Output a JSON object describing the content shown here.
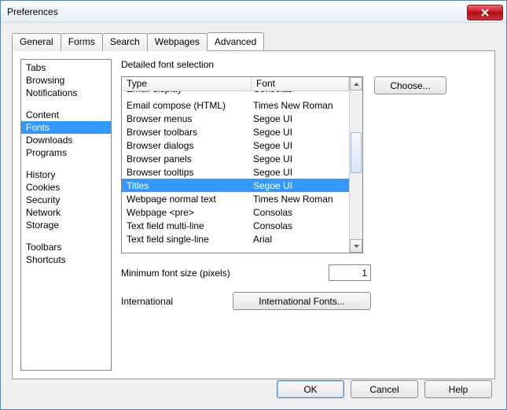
{
  "window": {
    "title": "Preferences"
  },
  "tabs": {
    "items": [
      "General",
      "Forms",
      "Search",
      "Webpages",
      "Advanced"
    ],
    "active": "Advanced"
  },
  "sidebar": {
    "groups": [
      [
        "Tabs",
        "Browsing",
        "Notifications"
      ],
      [
        "Content",
        "Fonts",
        "Downloads",
        "Programs"
      ],
      [
        "History",
        "Cookies",
        "Security",
        "Network",
        "Storage"
      ],
      [
        "Toolbars",
        "Shortcuts"
      ]
    ],
    "selected": "Fonts"
  },
  "main": {
    "heading": "Detailed font selection",
    "columns": {
      "type": "Type",
      "font": "Font"
    },
    "rows": [
      {
        "type": "Email display",
        "font": "Consolas"
      },
      {
        "type": "Email compose (HTML)",
        "font": "Times New Roman"
      },
      {
        "type": "Browser menus",
        "font": "Segoe UI"
      },
      {
        "type": "Browser toolbars",
        "font": "Segoe UI"
      },
      {
        "type": "Browser dialogs",
        "font": "Segoe UI"
      },
      {
        "type": "Browser panels",
        "font": "Segoe UI"
      },
      {
        "type": "Browser tooltips",
        "font": "Segoe UI"
      },
      {
        "type": "Titles",
        "font": "Segoe UI"
      },
      {
        "type": "Webpage normal text",
        "font": "Times New Roman"
      },
      {
        "type": "Webpage <pre>",
        "font": "Consolas"
      },
      {
        "type": "Text field multi-line",
        "font": "Consolas"
      },
      {
        "type": "Text field single-line",
        "font": "Arial"
      }
    ],
    "selected_row_index": 7,
    "choose_label": "Choose...",
    "min_font_label": "Minimum font size (pixels)",
    "min_font_value": "1",
    "international_label": "International",
    "international_button": "International Fonts..."
  },
  "buttons": {
    "ok": "OK",
    "cancel": "Cancel",
    "help": "Help"
  }
}
